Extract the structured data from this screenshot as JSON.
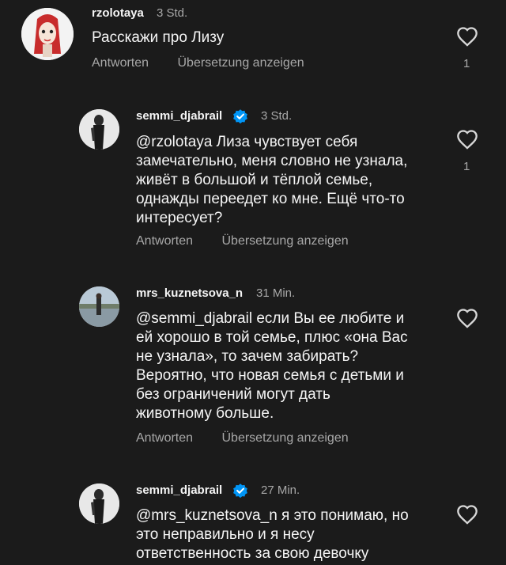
{
  "comments": [
    {
      "username": "rzolotaya",
      "time": "3 Std.",
      "text": "Расскажи про Лизу",
      "reply_label": "Antworten",
      "translate_label": "Übersetzung anzeigen",
      "likes": "1",
      "verified": false
    },
    {
      "username": "semmi_djabrail",
      "time": "3 Std.",
      "text_lines": [
        "@rzolotaya Лиза чувствует себя",
        "замечательно, меня словно не узнала,",
        "живёт в большой и тёплой семье,",
        "однажды переедет ко мне. Ещё что-то",
        "интересует?"
      ],
      "reply_label": "Antworten",
      "translate_label": "Übersetzung anzeigen",
      "likes": "1",
      "verified": true
    },
    {
      "username": "mrs_kuznetsova_n",
      "time": "31 Min.",
      "text_lines": [
        "@semmi_djabrail если Вы ее любите и",
        "ей хорошо в той семье, плюс «она Вас",
        "не узнала», то зачем забирать?",
        "Вероятно, что новая семья с детьми и",
        "без ограничений могут дать",
        "животному больше."
      ],
      "reply_label": "Antworten",
      "translate_label": "Übersetzung anzeigen",
      "verified": false
    },
    {
      "username": "semmi_djabrail",
      "time": "27 Min.",
      "text_lines": [
        "@mrs_kuznetsova_n я это понимаю, но",
        "это неправильно и я несу",
        "ответственность за свою девочку"
      ],
      "verified": true
    }
  ],
  "icons": {
    "like": "heart-outline-icon",
    "verified": "verified-badge-icon"
  },
  "colors": {
    "background": "#1b1b1b",
    "secondary_text": "#a8a8a8",
    "verified": "#0095f6"
  }
}
